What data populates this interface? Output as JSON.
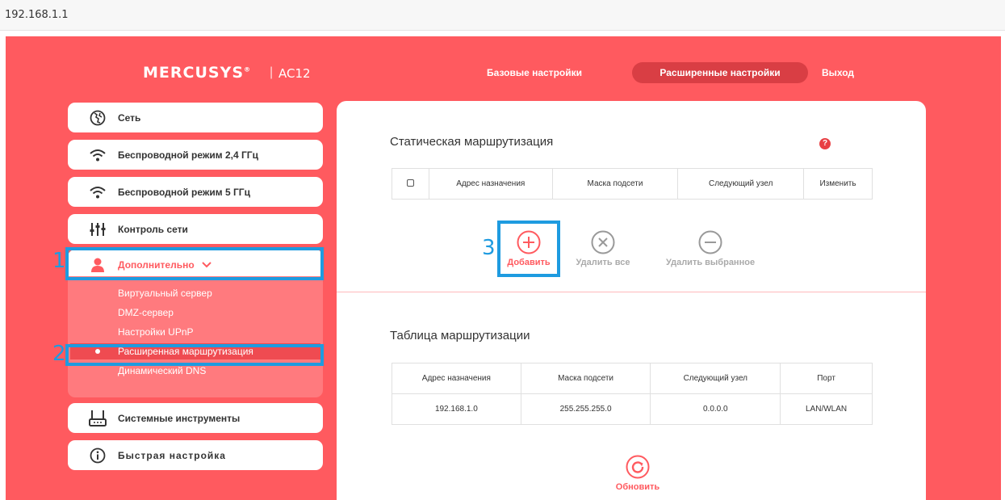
{
  "browser": {
    "url": "192.168.1.1"
  },
  "header": {
    "brand": "MERCUSYS",
    "brand_mark": "®",
    "separator": "|",
    "model": "AC12",
    "nav": {
      "basic": "Базовые настройки",
      "advanced": "Расширенные настройки",
      "logout": "Выход"
    }
  },
  "sidebar": {
    "items": [
      {
        "label": "Сеть",
        "icon": "globe-icon"
      },
      {
        "label": "Беспроводной режим 2,4 ГГц",
        "icon": "wifi-icon"
      },
      {
        "label": "Беспроводной режим 5 ГГц",
        "icon": "wifi-icon"
      },
      {
        "label": "Контроль сети",
        "icon": "sliders-icon"
      },
      {
        "label": "Дополнительно",
        "icon": "user-icon",
        "expanded": true
      },
      {
        "label": "Системные инструменты",
        "icon": "router-icon"
      },
      {
        "label": "Быстрая настройка",
        "icon": "info-icon"
      }
    ],
    "submenu": [
      {
        "label": "Виртуальный сервер"
      },
      {
        "label": "DMZ-сервер"
      },
      {
        "label": "Настройки UPnP"
      },
      {
        "label": "Расширенная маршрутизация",
        "selected": true
      },
      {
        "label": "Динамический DNS"
      }
    ]
  },
  "annotations": {
    "one": "1",
    "two": "2",
    "three": "3"
  },
  "static_routing": {
    "title": "Статическая маршрутизация",
    "help": "?",
    "columns": [
      "Адрес назначения",
      "Маска подсети",
      "Следующий узел",
      "Изменить"
    ],
    "actions": {
      "add": "Добавить",
      "delete_all": "Удалить все",
      "delete_selected": "Удалить выбранное"
    }
  },
  "routing_table": {
    "title": "Таблица маршрутизации",
    "columns": [
      "Адрес назначения",
      "Маска подсети",
      "Следующий узел",
      "Порт"
    ],
    "rows": [
      [
        "192.168.1.0",
        "255.255.255.0",
        "0.0.0.0",
        "LAN/WLAN"
      ]
    ],
    "refresh": "Обновить"
  },
  "colors": {
    "accent": "#ff5a5f",
    "accent_dark": "#d93e44",
    "annotation": "#1e9be0"
  }
}
